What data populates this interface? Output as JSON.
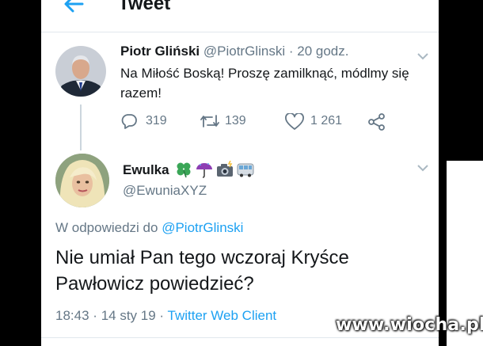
{
  "header": {
    "title": "Tweet"
  },
  "tweet1": {
    "author_name": "Piotr Gliński",
    "author_handle": "@PiotrGlinski",
    "separator": "·",
    "time_ago": "20 godz.",
    "text": "Na Miłość Boską! Proszę zamilknąć, módlmy się razem!",
    "replies": "319",
    "retweets": "139",
    "likes": "1 261"
  },
  "tweet2": {
    "author_name": "Ewulka",
    "author_handle": "@EwuniaXYZ",
    "name_emojis": [
      "four-leaf-clover-icon",
      "umbrella-icon",
      "camera-flash-icon",
      "bus-icon"
    ],
    "reply_prefix": "W odpowiedzi do",
    "reply_target": "@PiotrGlinski",
    "text": "Nie umiał Pan tego wczoraj Kryśce Pawłowicz powiedzieć?",
    "time": "18:43",
    "date": "14 sty 19",
    "meta_sep": "·",
    "client": "Twitter Web Client"
  },
  "watermark": "www.wiocha.pl",
  "colors": {
    "accent": "#1da1f2",
    "text": "#14171a",
    "muted": "#657786",
    "border": "#e1e8ed"
  }
}
